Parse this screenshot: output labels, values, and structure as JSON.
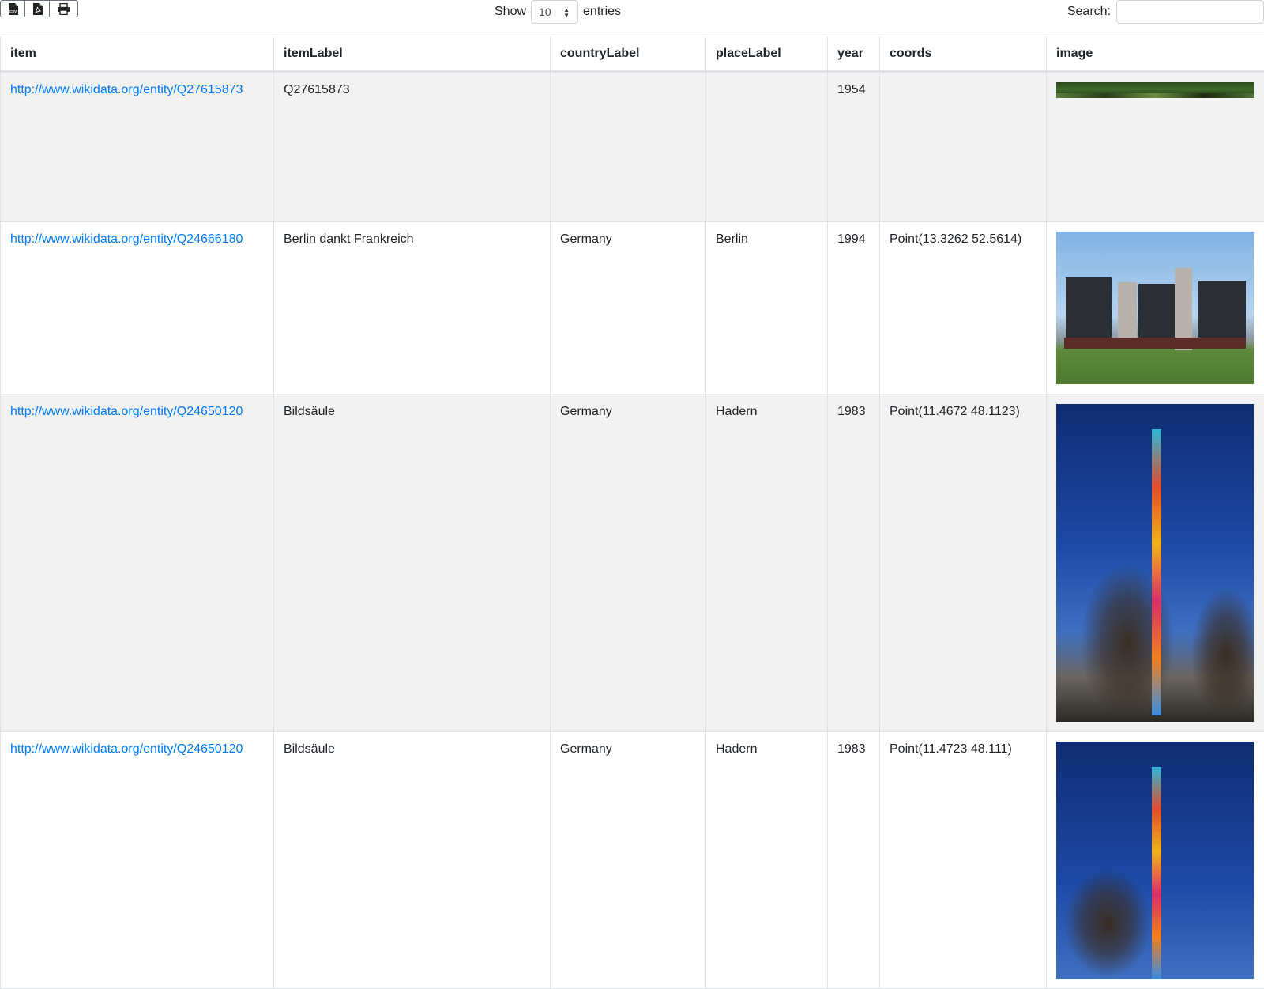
{
  "toolbar": {
    "export_buttons": [
      "csv-icon",
      "pdf-icon",
      "print-icon"
    ],
    "length_show": "Show",
    "length_value": "10",
    "length_entries": "entries",
    "search_label": "Search:",
    "search_value": ""
  },
  "table": {
    "columns": [
      "item",
      "itemLabel",
      "countryLabel",
      "placeLabel",
      "year",
      "coords",
      "image"
    ],
    "rows": [
      {
        "item": "http://www.wikidata.org/entity/Q27615873",
        "itemLabel": "Q27615873",
        "countryLabel": "",
        "placeLabel": "",
        "year": "1954",
        "coords": "",
        "image": "forest-photo"
      },
      {
        "item": "http://www.wikidata.org/entity/Q24666180",
        "itemLabel": "Berlin dankt Frankreich",
        "countryLabel": "Germany",
        "placeLabel": "Berlin",
        "year": "1994",
        "coords": "Point(13.3262 52.5614)",
        "image": "monument-photo"
      },
      {
        "item": "http://www.wikidata.org/entity/Q24650120",
        "itemLabel": "Bildsäule",
        "countryLabel": "Germany",
        "placeLabel": "Hadern",
        "year": "1983",
        "coords": "Point(11.4672 48.1123)",
        "image": "column-photo"
      },
      {
        "item": "http://www.wikidata.org/entity/Q24650120",
        "itemLabel": "Bildsäule",
        "countryLabel": "Germany",
        "placeLabel": "Hadern",
        "year": "1983",
        "coords": "Point(11.4723 48.111)",
        "image": "column-photo"
      }
    ]
  },
  "colors": {
    "link": "#007bff",
    "stripe": "#f2f2f2",
    "border": "#dee2e6"
  }
}
